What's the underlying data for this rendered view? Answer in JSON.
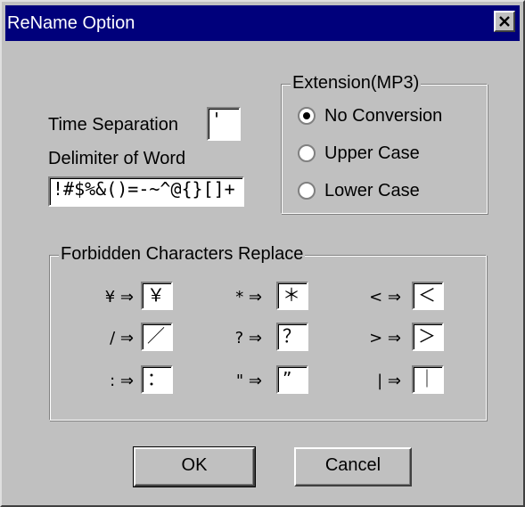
{
  "window": {
    "title": "ReName Option"
  },
  "time_separation": {
    "label": "Time Separation",
    "value": "'"
  },
  "delimiter": {
    "label": "Delimiter of Word",
    "value": "!#$%&()=-~^@{}[]+"
  },
  "extension": {
    "title": "Extension(MP3)",
    "options": [
      {
        "label": "No Conversion",
        "selected": true
      },
      {
        "label": "Upper Case",
        "selected": false
      },
      {
        "label": "Lower Case",
        "selected": false
      }
    ]
  },
  "forbidden": {
    "title": "Forbidden Characters Replace",
    "rows": [
      [
        {
          "from": "¥ ⇒",
          "to": "￥"
        },
        {
          "from": "* ⇒",
          "to": "＊"
        },
        {
          "from": "< ⇒",
          "to": "＜"
        }
      ],
      [
        {
          "from": "/ ⇒",
          "to": "／"
        },
        {
          "from": "? ⇒",
          "to": "？"
        },
        {
          "from": "> ⇒",
          "to": "＞"
        }
      ],
      [
        {
          "from": ": ⇒",
          "to": "："
        },
        {
          "from": "\" ⇒",
          "to": "”"
        },
        {
          "from": "| ⇒",
          "to": "｜"
        }
      ]
    ]
  },
  "buttons": {
    "ok": "OK",
    "cancel": "Cancel"
  }
}
